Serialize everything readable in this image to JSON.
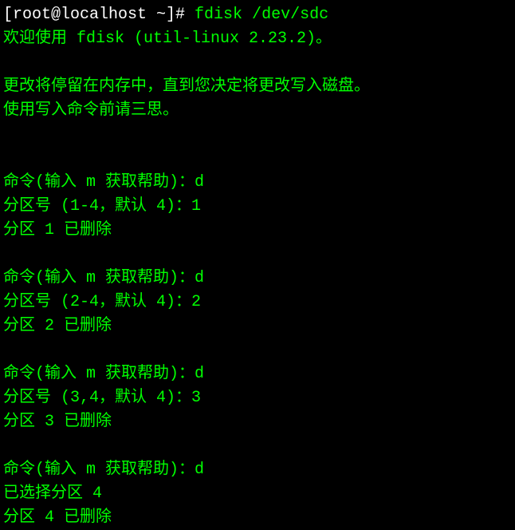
{
  "prompt": {
    "user_host": "[root@localhost ~]#",
    "command": " fdisk /dev/sdc"
  },
  "welcome": "欢迎使用 fdisk (util-linux 2.23.2)。",
  "warning1": "更改将停留在内存中，直到您决定将更改写入磁盘。",
  "warning2": "使用写入命令前请三思。",
  "block1": {
    "cmd_line": "命令(输入 m 获取帮助)：d",
    "partition_line": "分区号 (1-4，默认 4)：1",
    "result": "分区 1 已删除"
  },
  "block2": {
    "cmd_line": "命令(输入 m 获取帮助)：d",
    "partition_line": "分区号 (2-4，默认 4)：2",
    "result": "分区 2 已删除"
  },
  "block3": {
    "cmd_line": "命令(输入 m 获取帮助)：d",
    "partition_line": "分区号 (3,4，默认 4)：3",
    "result": "分区 3 已删除"
  },
  "block4": {
    "cmd_line": "命令(输入 m 获取帮助)：d",
    "selected_line": "已选择分区 4",
    "result": "分区 4 已删除"
  }
}
